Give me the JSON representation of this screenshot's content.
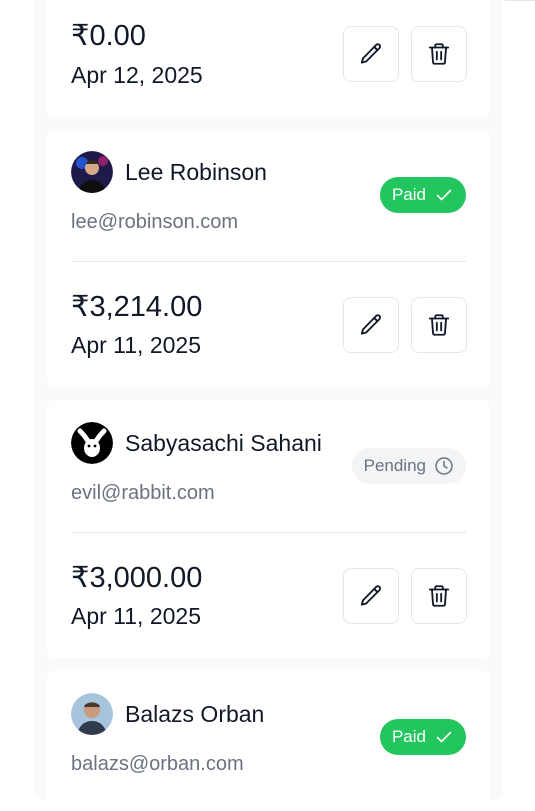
{
  "invoices": [
    {
      "amount": "₹0.00",
      "date": "Apr 12, 2025"
    },
    {
      "name": "Lee Robinson",
      "email": "lee@robinson.com",
      "status": "Paid",
      "amount": "₹3,214.00",
      "date": "Apr 11, 2025"
    },
    {
      "name": "Sabyasachi Sahani",
      "email": "evil@rabbit.com",
      "status": "Pending",
      "amount": "₹3,000.00",
      "date": "Apr 11, 2025"
    },
    {
      "name": "Balazs Orban",
      "email": "balazs@orban.com",
      "status": "Paid"
    }
  ],
  "colors": {
    "paid": "#22c55e",
    "pending_bg": "#f3f4f6",
    "muted_text": "#6b7280",
    "border": "#e5e7eb"
  },
  "icons": {
    "edit": "pencil-icon",
    "delete": "trash-icon",
    "paid": "check-icon",
    "pending": "clock-icon"
  }
}
